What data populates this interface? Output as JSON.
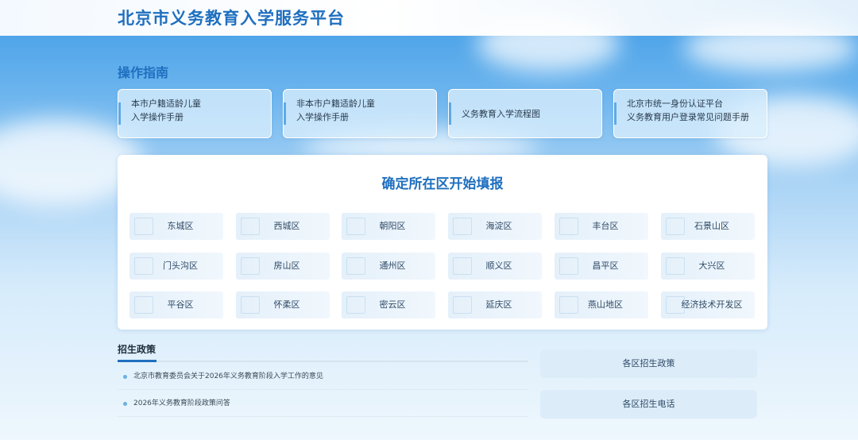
{
  "header": {
    "site_title": "北京市义务教育入学服务平台"
  },
  "guide": {
    "title": "操作指南",
    "cards": [
      {
        "line1": "本市户籍适龄儿童",
        "line2": "入学操作手册"
      },
      {
        "line1": "非本市户籍适龄儿童",
        "line2": "入学操作手册"
      },
      {
        "line1": "义务教育入学流程图",
        "line2": ""
      },
      {
        "line1": "北京市统一身份认证平台",
        "line2": "义务教育用户登录常见问题手册"
      }
    ]
  },
  "districts": {
    "heading": "确定所在区开始填报",
    "items": [
      "东城区",
      "西城区",
      "朝阳区",
      "海淀区",
      "丰台区",
      "石景山区",
      "门头沟区",
      "房山区",
      "通州区",
      "顺义区",
      "昌平区",
      "大兴区",
      "平谷区",
      "怀柔区",
      "密云区",
      "延庆区",
      "燕山地区",
      "经济技术开发区"
    ]
  },
  "policy": {
    "title": "招生政策",
    "items": [
      "北京市教育委员会关于2026年义务教育阶段入学工作的意见",
      "2026年义务教育阶段政策问答"
    ]
  },
  "side_links": {
    "district_policy": "各区招生政策",
    "district_phone": "各区招生电话"
  }
}
